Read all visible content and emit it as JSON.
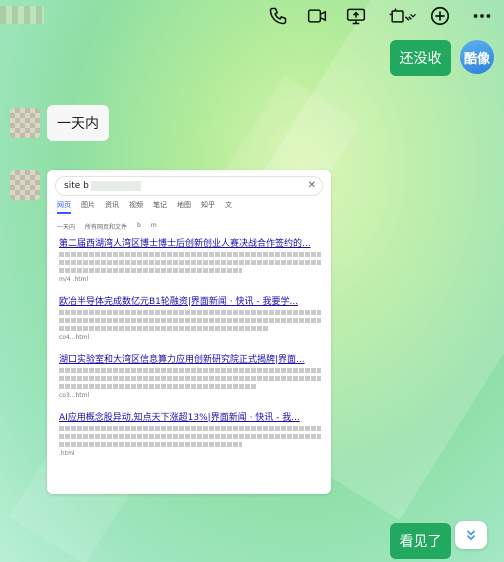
{
  "toolbar": {
    "icons": [
      "phone-icon",
      "video-icon",
      "screen-share-icon",
      "screenshot-icon",
      "add-icon"
    ]
  },
  "messages": {
    "msg1": "还没收",
    "msg2": "一天内",
    "msg3": "看见了"
  },
  "my_avatar_text": "酷像",
  "search_card": {
    "query_prefix": "site b",
    "tabs": [
      "网页",
      "图片",
      "资讯",
      "视频",
      "笔记",
      "地图",
      "知乎",
      "文"
    ],
    "filters": [
      "一天内",
      "所有网页和文件",
      "b",
      "m"
    ],
    "results": [
      {
        "title": "第二届西湖湾人湾区博士博士后创新创业人赛决战合作签约的...",
        "source": "m/4 .html"
      },
      {
        "title": "欧冶半导体完成数亿元B1轮融资|界面新闻 · 快讯 - 我要学...",
        "source": "co4...html"
      },
      {
        "title": "湖口实验室和大湾区信息算力应用创新研究院正式揭牌|界面...",
        "source": "co3...html"
      },
      {
        "title": "AI应用概念股异动,知点天下涨超13%|界面新闻 · 快讯 - 我...",
        "source": ".html"
      }
    ]
  }
}
